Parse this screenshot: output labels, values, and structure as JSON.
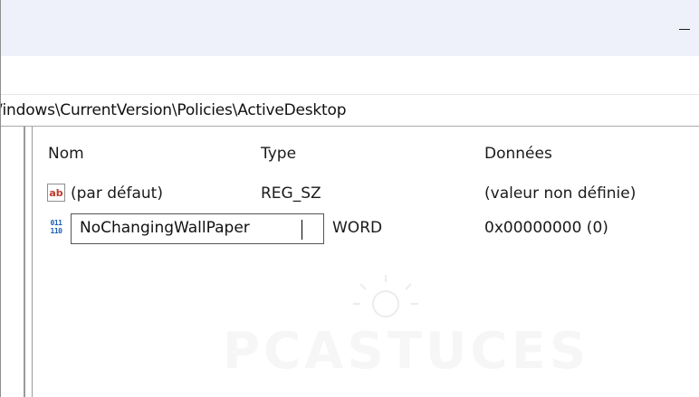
{
  "address": {
    "path": "/indows\\CurrentVersion\\Policies\\ActiveDesktop"
  },
  "window_controls": {
    "minimize_icon": "minimize-icon"
  },
  "list": {
    "columns": [
      "Nom",
      "Type",
      "Données"
    ],
    "rows": [
      {
        "icon": "string-value-icon",
        "icon_glyph": "ab",
        "name": "(par défaut)",
        "type": "REG_SZ",
        "data": "(valeur non définie)"
      },
      {
        "icon": "binary-value-icon",
        "icon_glyph_top": "011",
        "icon_glyph_bottom": "110",
        "name": "NoChangingWallPaper",
        "type": "WORD",
        "data": "0x00000000 (0)"
      }
    ]
  },
  "watermark": {
    "text": "PCASTUCES"
  },
  "colors": {
    "titlebar_bg": "#eef1f9",
    "string_icon": "#c0392b",
    "binary_icon": "#1d5fb8"
  }
}
